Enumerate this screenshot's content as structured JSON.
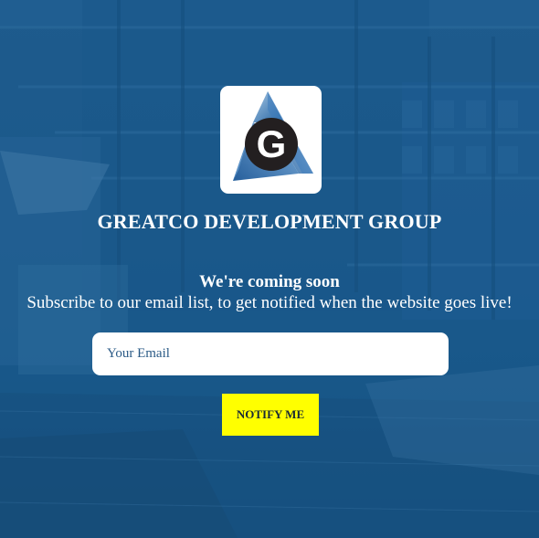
{
  "brand": {
    "logo_letter": "G",
    "company_name": "GREATCO DEVELOPMENT GROUP",
    "primary_color": "#1d5b8d",
    "logo_colors": [
      "#6aa0d3",
      "#1a5a9a",
      "#222222"
    ]
  },
  "announcement": {
    "heading": "We're coming soon",
    "subtitle": "Subscribe to our email list, to get notified when the website goes live!"
  },
  "signup": {
    "email_placeholder": "Your Email",
    "email_value": "",
    "button_label": "NOTIFY ME",
    "button_color": "#ffff00"
  }
}
